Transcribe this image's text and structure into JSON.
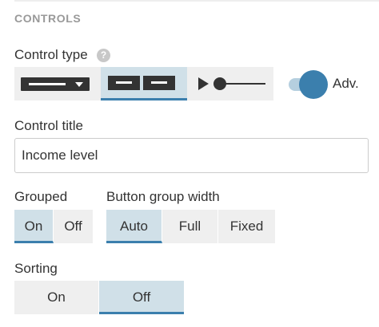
{
  "section": {
    "header": "CONTROLS"
  },
  "control_type": {
    "label": "Control type",
    "help_icon": "?",
    "options": [
      {
        "name": "dropdown-icon",
        "active": false
      },
      {
        "name": "button-group-icon",
        "active": true
      },
      {
        "name": "slider-icon",
        "active": false
      }
    ],
    "advanced": {
      "label": "Adv.",
      "enabled": true
    }
  },
  "control_title": {
    "label": "Control title",
    "value": "Income level"
  },
  "grouped": {
    "label": "Grouped",
    "options": [
      "On",
      "Off"
    ],
    "selected": "On"
  },
  "button_group_width": {
    "label": "Button group width",
    "options": [
      "Auto",
      "Full",
      "Fixed"
    ],
    "selected": "Auto"
  },
  "sorting": {
    "label": "Sorting",
    "options": [
      "On",
      "Off"
    ],
    "selected": "Off"
  },
  "colors": {
    "accent": "#3b7fad",
    "active_bg": "#d0e0e8",
    "inactive_bg": "#efefef",
    "toggle_track": "#b5cfdf"
  }
}
